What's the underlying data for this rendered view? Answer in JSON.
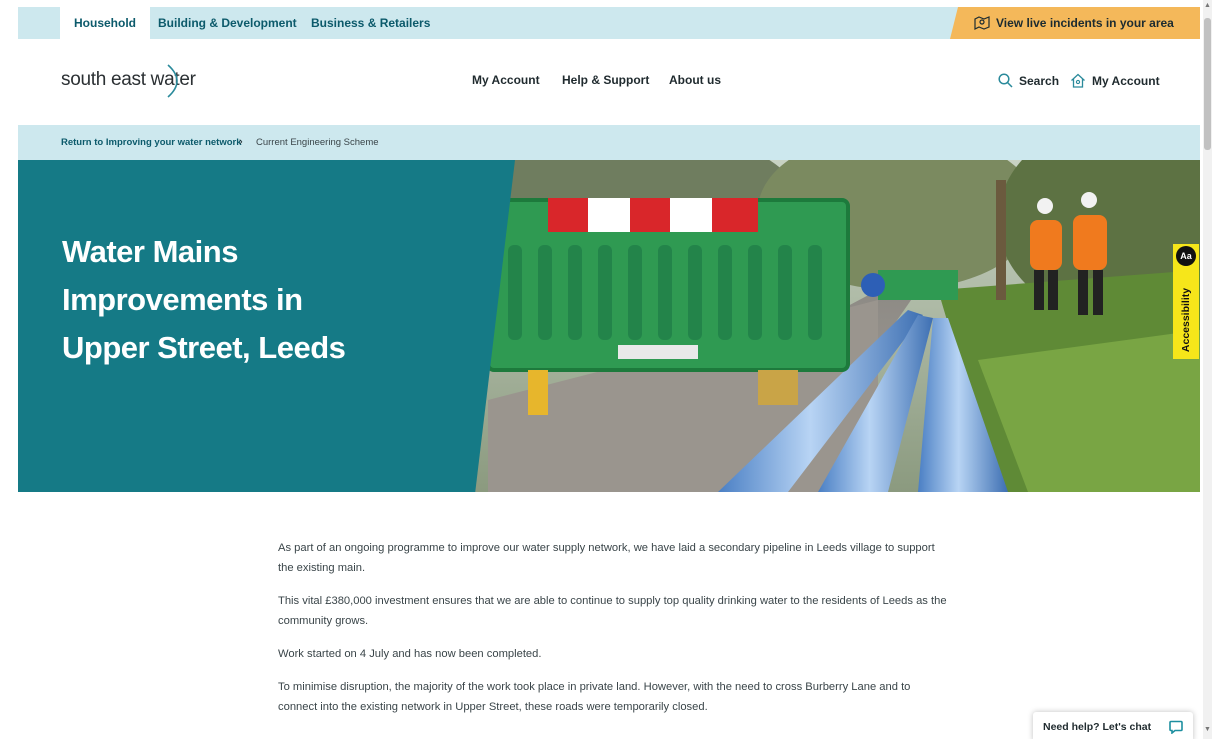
{
  "topbar": {
    "tabs": [
      {
        "label": "Household"
      },
      {
        "label": "Building & Development"
      },
      {
        "label": "Business & Retailers"
      }
    ],
    "incidents_label": "View live incidents in your area"
  },
  "header": {
    "logo_text": "south east water",
    "nav": [
      {
        "label": "My Account"
      },
      {
        "label": "Help & Support"
      },
      {
        "label": "About us"
      }
    ],
    "search_label": "Search",
    "account_label": "My Account"
  },
  "breadcrumb": {
    "link": "Return to Improving your water network",
    "separator": "›",
    "current": "Current Engineering Scheme"
  },
  "hero": {
    "title": "Water Mains Improvements in Upper Street, Leeds"
  },
  "accessibility": {
    "badge": "Aa",
    "label": "Accessibility"
  },
  "content": {
    "paragraphs": [
      "As part of an ongoing programme to improve our water supply network, we have laid a secondary pipeline in Leeds village to support the existing main.",
      "This vital £380,000 investment ensures that we are able to continue to supply top quality drinking water to the residents of Leeds as the community grows.",
      "Work started on 4 July and has now been completed.",
      "To minimise disruption, the majority of the work took place in private land. However, with the need to cross Burberry Lane and to connect into the existing network in Upper Street, these roads were temporarily closed."
    ]
  },
  "chat": {
    "label": "Need help? Let's chat"
  },
  "colors": {
    "teal": "#157a86",
    "light_teal": "#cde8ee",
    "incidents_orange": "#f4b85a",
    "accessibility_yellow": "#f6e61a"
  }
}
